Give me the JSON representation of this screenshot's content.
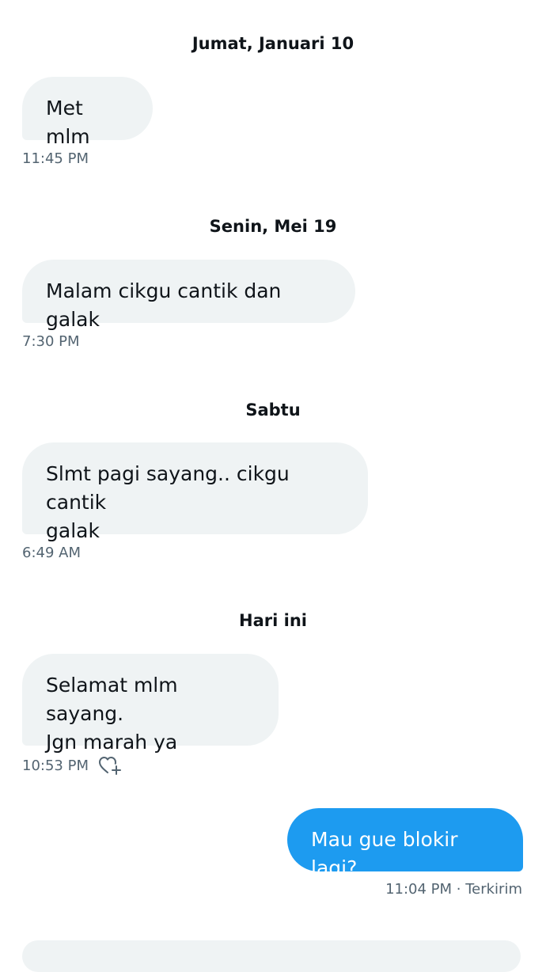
{
  "messages": [
    {
      "date": "Jumat, Januari 10",
      "text": "Met mlm",
      "time": "11:45 PM"
    },
    {
      "date": "Senin, Mei 19",
      "text": "Malam cikgu cantik dan galak",
      "time": "7:30 PM"
    },
    {
      "date": "Sabtu",
      "line1": "Slmt pagi sayang.. cikgu cantik",
      "line2": "galak",
      "time": "6:49 AM"
    },
    {
      "date": "Hari ini",
      "line1": "Selamat mlm sayang.",
      "line2": "Jgn marah ya",
      "time": "10:53 PM",
      "reaction_icon": "heart-plus-icon"
    }
  ],
  "sent": {
    "text": "Mau gue blokir lagi?",
    "time": "11:04 PM",
    "status": "Terkirim",
    "separator": " · "
  },
  "colors": {
    "sent_bubble": "#1d9bf0",
    "received_bubble": "#eff3f4",
    "meta_text": "#536471"
  }
}
